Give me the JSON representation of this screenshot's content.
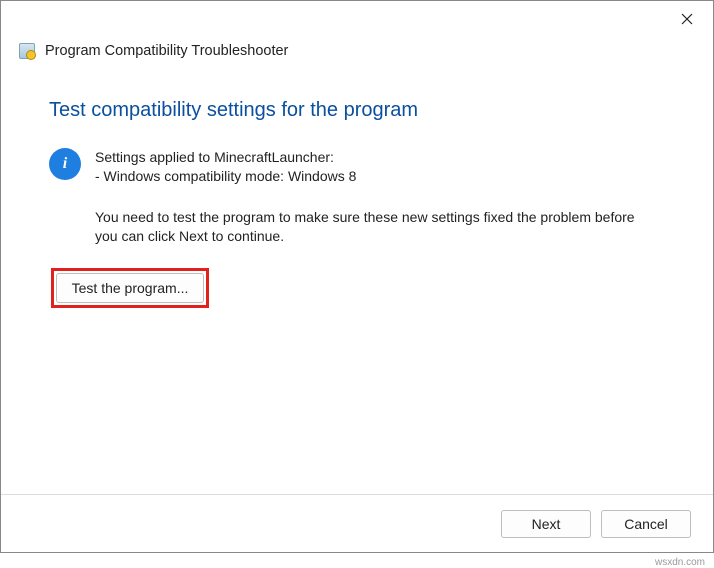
{
  "titlebar": {
    "close_name": "close-icon"
  },
  "header": {
    "title": "Program Compatibility Troubleshooter"
  },
  "main": {
    "heading": "Test compatibility settings for the program",
    "info_line1": "Settings applied to MinecraftLauncher:",
    "info_line2": "- Windows compatibility mode: Windows 8",
    "description": "You need to test the program to make sure these new settings fixed the problem before you can click Next to continue.",
    "test_button_label": "Test the program..."
  },
  "footer": {
    "next_label": "Next",
    "cancel_label": "Cancel"
  },
  "watermark": "wsxdn.com"
}
